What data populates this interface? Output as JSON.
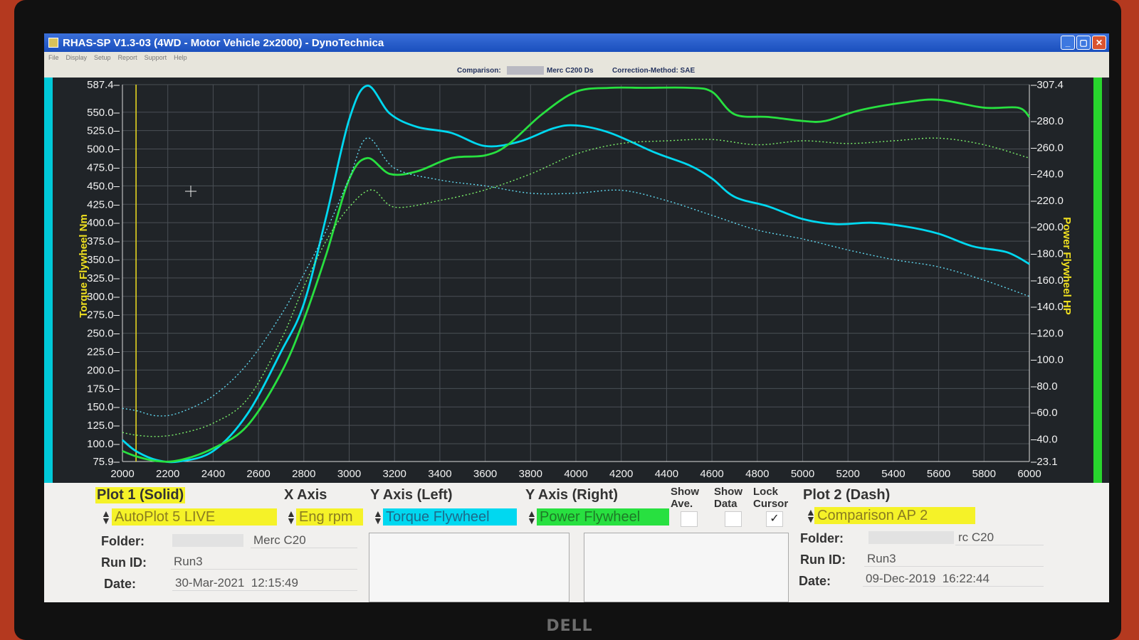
{
  "window": {
    "title": "RHAS-SP V1.3-03  (4WD - Motor Vehicle 2x2000) - DynoTechnica",
    "menu": [
      "File",
      "Display",
      "Setup",
      "Report",
      "Support",
      "Help"
    ],
    "controls": [
      "minimize",
      "maximize",
      "close"
    ]
  },
  "infobar": {
    "comparison_label": "Comparison:",
    "comparison_value": "Merc C200 Ds",
    "correction": "Correction-Method: SAE"
  },
  "chart_data": {
    "type": "line",
    "xlabel": "",
    "ylabel_left": "Torque Flywheel Nm",
    "ylabel_right": "Power Flywheel HP",
    "xlim": [
      2000,
      6000
    ],
    "ylim_left": [
      75.9,
      587.4
    ],
    "ylim_right": [
      23.1,
      307.4
    ],
    "x_ticks": [
      "2000",
      "2200",
      "2400",
      "2600",
      "2800",
      "3000",
      "3200",
      "3400",
      "3600",
      "3800",
      "4000",
      "4200",
      "4400",
      "4600",
      "4800",
      "5000",
      "5200",
      "5400",
      "5600",
      "5800",
      "6000"
    ],
    "y_left_ticks": [
      "587.4",
      "550.0",
      "525.0",
      "500.0",
      "475.0",
      "450.0",
      "425.0",
      "400.0",
      "375.0",
      "350.0",
      "325.0",
      "300.0",
      "275.0",
      "250.0",
      "225.0",
      "200.0",
      "175.0",
      "150.0",
      "125.0",
      "100.0",
      "75.9"
    ],
    "y_right_ticks": [
      "307.4",
      "280.0",
      "260.0",
      "240.0",
      "220.0",
      "200.0",
      "180.0",
      "160.0",
      "140.0",
      "120.0",
      "100.0",
      "80.0",
      "60.0",
      "40.0",
      "23.1"
    ],
    "grid": true,
    "cursor_rpm": 2060,
    "series": [
      {
        "axis": "left",
        "style": "solid",
        "color": "#00d8f0",
        "x": [
          2000,
          2060,
          2150,
          2250,
          2400,
          2550,
          2700,
          2800,
          2900,
          3000,
          3080,
          3180,
          3300,
          3450,
          3600,
          3750,
          3900,
          4000,
          4150,
          4350,
          4500,
          4600,
          4700,
          4850,
          5000,
          5150,
          5300,
          5450,
          5600,
          5750,
          5900,
          6000
        ],
        "y": [
          105,
          90,
          78,
          76,
          90,
          140,
          225,
          290,
          410,
          540,
          586,
          548,
          530,
          522,
          504,
          510,
          528,
          532,
          522,
          495,
          478,
          460,
          435,
          422,
          405,
          398,
          400,
          395,
          385,
          368,
          360,
          344
        ]
      },
      {
        "axis": "right",
        "style": "solid",
        "color": "#28e040",
        "x": [
          2000,
          2060,
          2150,
          2250,
          2400,
          2550,
          2700,
          2800,
          2900,
          3000,
          3080,
          3180,
          3300,
          3450,
          3600,
          3700,
          3850,
          4000,
          4150,
          4300,
          4500,
          4600,
          4700,
          4850,
          5000,
          5100,
          5250,
          5450,
          5600,
          5800,
          5950,
          6000
        ],
        "y": [
          31,
          27,
          23.5,
          24,
          33,
          50,
          90,
          130,
          180,
          236,
          252,
          240,
          242,
          252,
          254,
          262,
          285,
          302,
          305,
          305,
          305,
          302,
          285,
          283,
          280,
          280,
          288,
          294,
          296,
          290,
          290,
          283
        ]
      },
      {
        "axis": "left",
        "style": "dash",
        "color": "#60d8f0",
        "x": [
          2000,
          2060,
          2150,
          2250,
          2400,
          2550,
          2700,
          2800,
          2900,
          3000,
          3080,
          3200,
          3400,
          3600,
          3800,
          4000,
          4200,
          4400,
          4600,
          4800,
          5000,
          5200,
          5400,
          5600,
          5800,
          6000
        ],
        "y": [
          148,
          145,
          138,
          142,
          165,
          208,
          275,
          330,
          390,
          460,
          515,
          474,
          458,
          450,
          440,
          440,
          444,
          430,
          410,
          390,
          378,
          363,
          350,
          340,
          322,
          300
        ]
      },
      {
        "axis": "right",
        "style": "dash",
        "color": "#7cf26a",
        "x": [
          2000,
          2060,
          2150,
          2250,
          2400,
          2550,
          2700,
          2800,
          2900,
          3000,
          3100,
          3200,
          3400,
          3600,
          3800,
          4000,
          4200,
          4400,
          4600,
          4800,
          5000,
          5200,
          5400,
          5600,
          5800,
          6000
        ],
        "y": [
          45,
          43,
          42,
          44,
          52,
          70,
          115,
          155,
          190,
          215,
          228,
          215,
          220,
          228,
          240,
          255,
          263,
          265,
          266,
          262,
          265,
          263,
          265,
          267,
          262,
          252
        ]
      }
    ]
  },
  "panel": {
    "plot1_title": "Plot 1 (Solid)",
    "xaxis_title": "X Axis",
    "yleft_title": "Y Axis (Left)",
    "yright_title": "Y Axis (Right)",
    "show_ave": "Show\nAve.",
    "show_data": "Show\nData",
    "lock_cursor": "Lock\nCursor",
    "plot2_title": "Plot 2 (Dash)",
    "plot1_select": "AutoPlot 5 LIVE",
    "xaxis_select": "Eng rpm",
    "yleft_select": "Torque Flywheel",
    "yright_select": "Power Flywheel",
    "plot2_select": "Comparison AP 2",
    "lock_cursor_checked": "✓",
    "folder_label": "Folder:",
    "runid_label": "Run ID:",
    "date_label": "Date:",
    "plot1_folder": "Merc C20",
    "plot1_runid": "Run3",
    "plot1_date": "30-Mar-2021  12:15:49",
    "plot2_folder": "rc C20",
    "plot2_runid": "Run3",
    "plot2_date": "09-Dec-2019  16:22:44"
  },
  "monitor": {
    "brand": "DELL"
  },
  "colors": {
    "torque": "#00d8f0",
    "power": "#28e040",
    "axis_label": "#f0e020",
    "background": "#202428"
  }
}
